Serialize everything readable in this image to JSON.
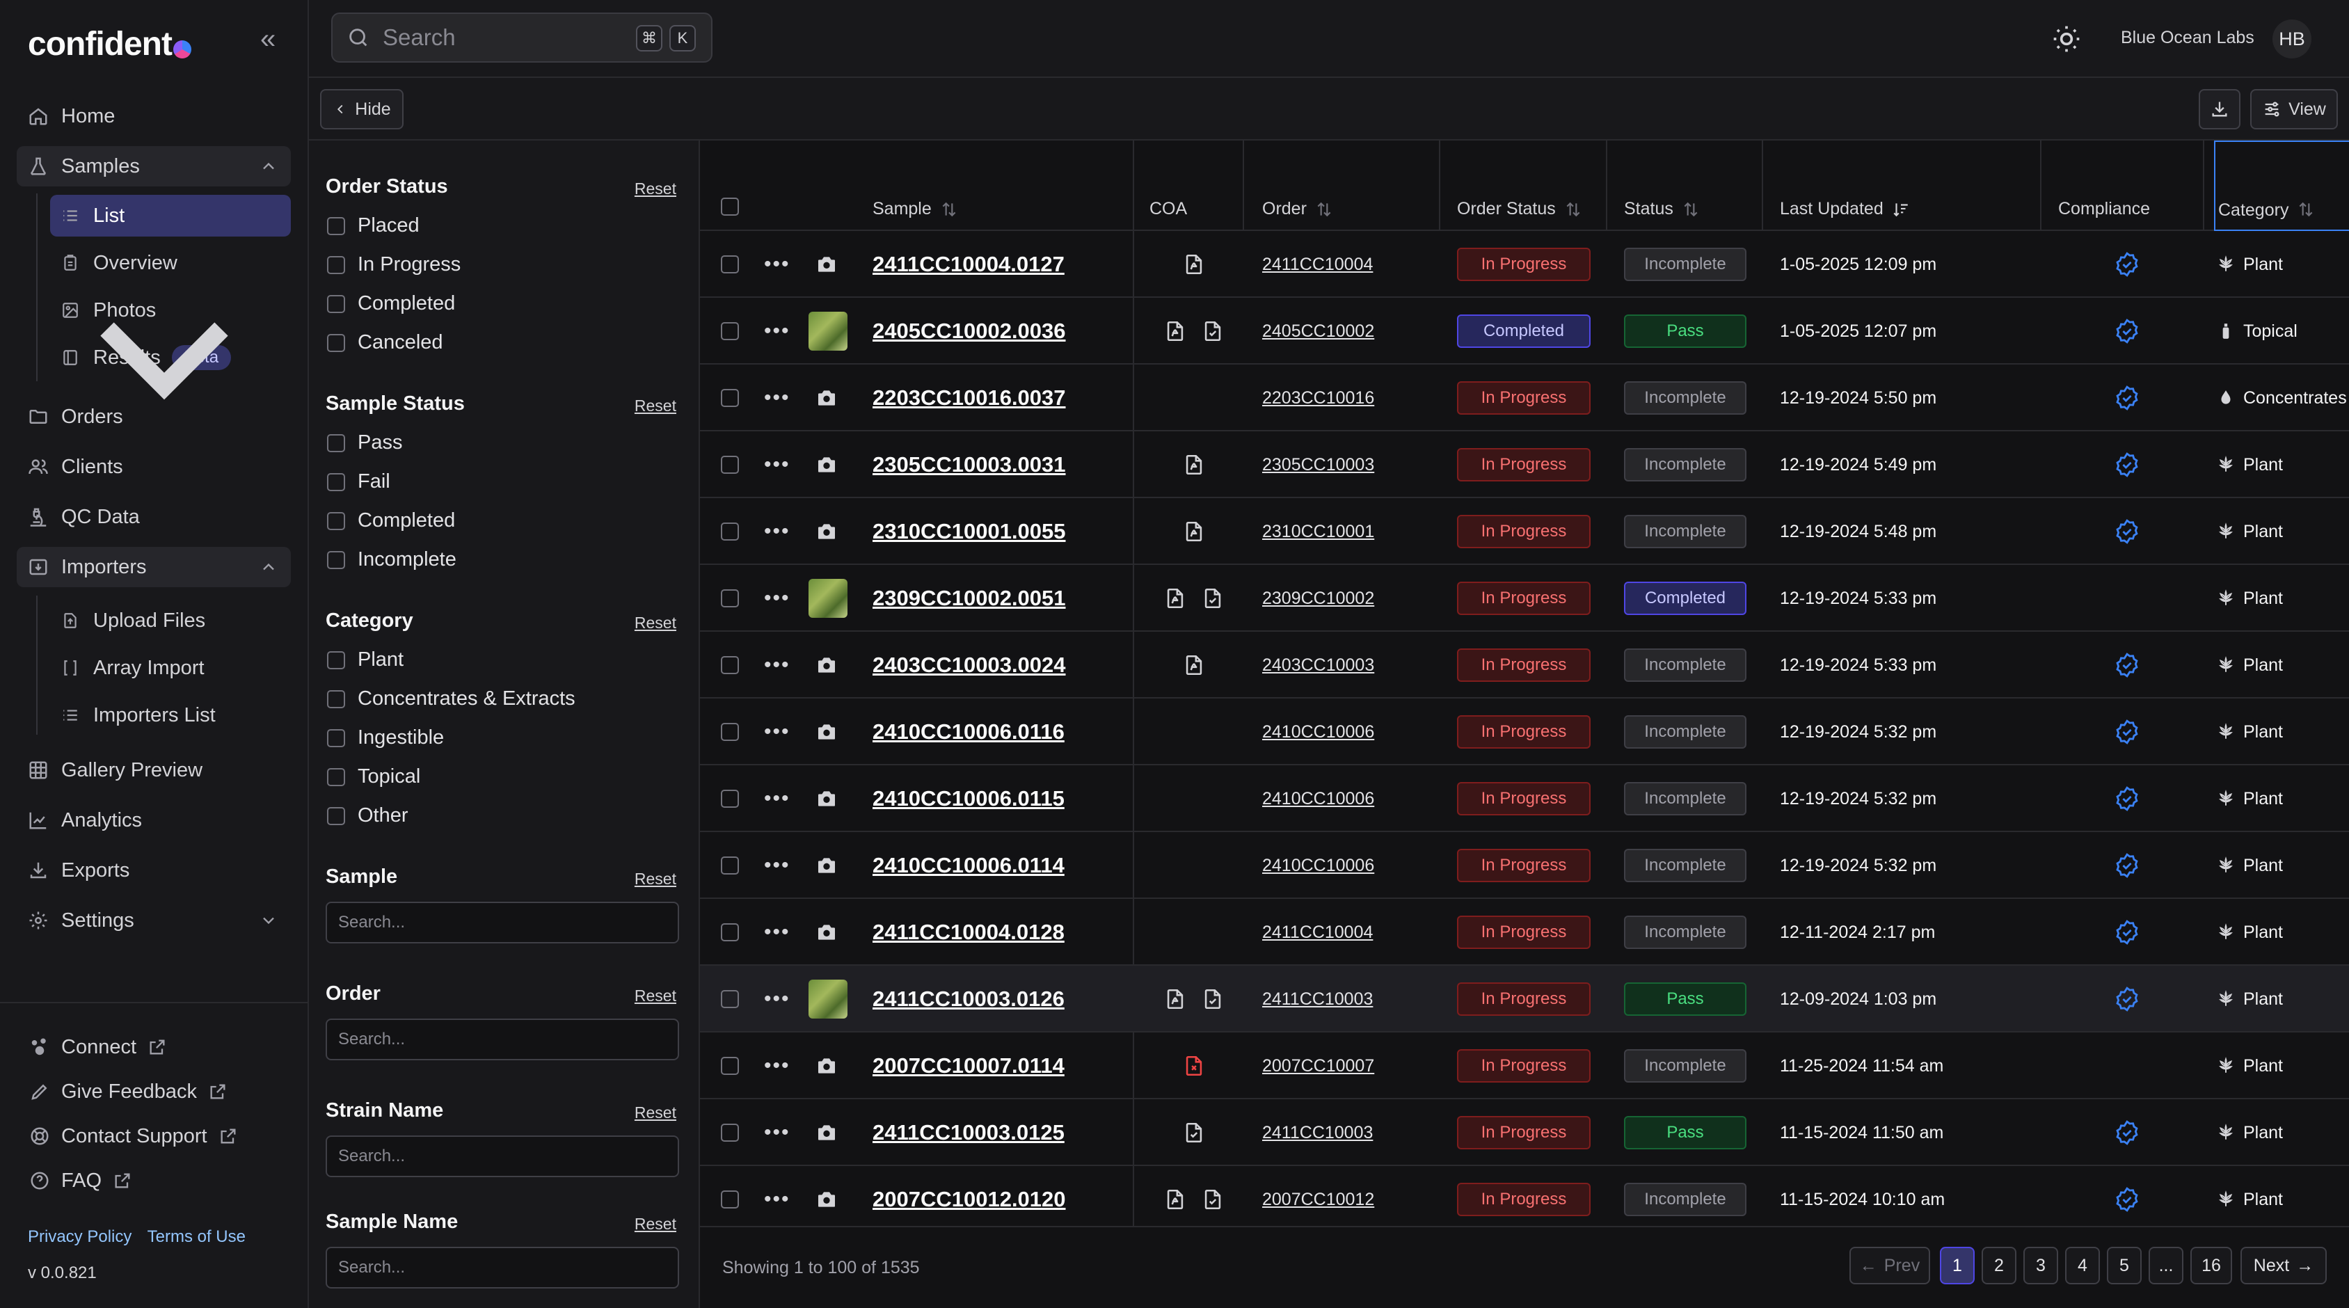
{
  "brand": {
    "name": "confident"
  },
  "nav": {
    "home": "Home",
    "samples": "Samples",
    "samples_sub": [
      "List",
      "Overview",
      "Photos",
      "Results"
    ],
    "results_badge": "Beta",
    "orders": "Orders",
    "clients": "Clients",
    "qc_data": "QC Data",
    "importers": "Importers",
    "importers_sub": [
      "Upload Files",
      "Array Import",
      "Importers List"
    ],
    "gallery": "Gallery Preview",
    "analytics": "Analytics",
    "exports": "Exports",
    "settings": "Settings",
    "connect": "Connect",
    "feedback": "Give Feedback",
    "support": "Contact Support",
    "faq": "FAQ",
    "privacy": "Privacy Policy",
    "terms": "Terms of Use",
    "version": "v 0.0.821"
  },
  "topbar": {
    "search_placeholder": "Search",
    "kbd_cmd": "⌘",
    "kbd_k": "K",
    "org": "Blue Ocean Labs",
    "user_initials": "HB"
  },
  "toolbar": {
    "hide_label": "Hide",
    "view_label": "View"
  },
  "filters": {
    "reset": "Reset",
    "order_status": {
      "title": "Order Status",
      "options": [
        "Placed",
        "In Progress",
        "Completed",
        "Canceled"
      ]
    },
    "sample_status": {
      "title": "Sample Status",
      "options": [
        "Pass",
        "Fail",
        "Completed",
        "Incomplete"
      ]
    },
    "category": {
      "title": "Category",
      "options": [
        "Plant",
        "Concentrates & Extracts",
        "Ingestible",
        "Topical",
        "Other"
      ]
    },
    "sample": {
      "title": "Sample",
      "placeholder": "Search..."
    },
    "order": {
      "title": "Order",
      "placeholder": "Search..."
    },
    "strain": {
      "title": "Strain Name",
      "placeholder": "Search..."
    },
    "sample_name": {
      "title": "Sample Name",
      "placeholder": "Search..."
    }
  },
  "table": {
    "columns": [
      "Sample",
      "COA",
      "Order",
      "Order Status",
      "Status",
      "Last Updated",
      "Compliance",
      "Category"
    ],
    "rows": [
      {
        "sample": "2411CC10004.0127",
        "photo": "camera",
        "coa": [
          "doc"
        ],
        "order": "2411CC10004",
        "order_status": "In Progress",
        "status": "Incomplete",
        "updated": "1-05-2025 12:09 pm",
        "compliance": true,
        "category": "Plant",
        "cat_icon": "leaf-icon"
      },
      {
        "sample": "2405CC10002.0036",
        "photo": "thumb",
        "coa": [
          "doc",
          "doc-check"
        ],
        "order": "2405CC10002",
        "order_status": "Completed",
        "status": "Pass",
        "updated": "1-05-2025 12:07 pm",
        "compliance": true,
        "category": "Topical",
        "cat_icon": "bottle-icon"
      },
      {
        "sample": "2203CC10016.0037",
        "photo": "camera",
        "coa": [],
        "order": "2203CC10016",
        "order_status": "In Progress",
        "status": "Incomplete",
        "updated": "12-19-2024 5:50 pm",
        "compliance": true,
        "category": "Concentrates",
        "cat_icon": "drop-icon"
      },
      {
        "sample": "2305CC10003.0031",
        "photo": "camera",
        "coa": [
          "doc"
        ],
        "order": "2305CC10003",
        "order_status": "In Progress",
        "status": "Incomplete",
        "updated": "12-19-2024 5:49 pm",
        "compliance": true,
        "category": "Plant",
        "cat_icon": "leaf-icon"
      },
      {
        "sample": "2310CC10001.0055",
        "photo": "camera",
        "coa": [
          "doc"
        ],
        "order": "2310CC10001",
        "order_status": "In Progress",
        "status": "Incomplete",
        "updated": "12-19-2024 5:48 pm",
        "compliance": true,
        "category": "Plant",
        "cat_icon": "leaf-icon"
      },
      {
        "sample": "2309CC10002.0051",
        "photo": "thumb",
        "coa": [
          "doc",
          "doc-check"
        ],
        "order": "2309CC10002",
        "order_status": "In Progress",
        "status": "Completed",
        "updated": "12-19-2024 5:33 pm",
        "compliance": false,
        "category": "Plant",
        "cat_icon": "leaf-icon"
      },
      {
        "sample": "2403CC10003.0024",
        "photo": "camera",
        "coa": [
          "doc"
        ],
        "order": "2403CC10003",
        "order_status": "In Progress",
        "status": "Incomplete",
        "updated": "12-19-2024 5:33 pm",
        "compliance": true,
        "category": "Plant",
        "cat_icon": "leaf-icon"
      },
      {
        "sample": "2410CC10006.0116",
        "photo": "camera",
        "coa": [],
        "order": "2410CC10006",
        "order_status": "In Progress",
        "status": "Incomplete",
        "updated": "12-19-2024 5:32 pm",
        "compliance": true,
        "category": "Plant",
        "cat_icon": "leaf-icon"
      },
      {
        "sample": "2410CC10006.0115",
        "photo": "camera",
        "coa": [],
        "order": "2410CC10006",
        "order_status": "In Progress",
        "status": "Incomplete",
        "updated": "12-19-2024 5:32 pm",
        "compliance": true,
        "category": "Plant",
        "cat_icon": "leaf-icon"
      },
      {
        "sample": "2410CC10006.0114",
        "photo": "camera",
        "coa": [],
        "order": "2410CC10006",
        "order_status": "In Progress",
        "status": "Incomplete",
        "updated": "12-19-2024 5:32 pm",
        "compliance": true,
        "category": "Plant",
        "cat_icon": "leaf-icon"
      },
      {
        "sample": "2411CC10004.0128",
        "photo": "camera",
        "coa": [],
        "order": "2411CC10004",
        "order_status": "In Progress",
        "status": "Incomplete",
        "updated": "12-11-2024 2:17 pm",
        "compliance": true,
        "category": "Plant",
        "cat_icon": "leaf-icon"
      },
      {
        "sample": "2411CC10003.0126",
        "photo": "thumb",
        "coa": [
          "doc",
          "doc-check"
        ],
        "order": "2411CC10003",
        "order_status": "In Progress",
        "status": "Pass",
        "updated": "12-09-2024 1:03 pm",
        "compliance": true,
        "category": "Plant",
        "cat_icon": "leaf-icon",
        "highlight": true
      },
      {
        "sample": "2007CC10007.0114",
        "photo": "camera",
        "coa": [
          "doc-error"
        ],
        "order": "2007CC10007",
        "order_status": "In Progress",
        "status": "Incomplete",
        "updated": "11-25-2024 11:54 am",
        "compliance": false,
        "category": "Plant",
        "cat_icon": "leaf-icon"
      },
      {
        "sample": "2411CC10003.0125",
        "photo": "camera",
        "coa": [
          "doc-check"
        ],
        "order": "2411CC10003",
        "order_status": "In Progress",
        "status": "Pass",
        "updated": "11-15-2024 11:50 am",
        "compliance": true,
        "category": "Plant",
        "cat_icon": "leaf-icon"
      },
      {
        "sample": "2007CC10012.0120",
        "photo": "camera",
        "coa": [
          "doc",
          "doc-check"
        ],
        "order": "2007CC10012",
        "order_status": "In Progress",
        "status": "Incomplete",
        "updated": "11-15-2024 10:10 am",
        "compliance": true,
        "category": "Plant",
        "cat_icon": "leaf-icon"
      }
    ]
  },
  "footer": {
    "showing": "Showing 1 to 100 of 1535",
    "prev": "Prev",
    "next": "Next",
    "pages": [
      "1",
      "2",
      "3",
      "4",
      "5",
      "...",
      "16"
    ],
    "current_page": "1"
  },
  "colors": {
    "accent": "#34356a",
    "in_progress": "#f87171",
    "pass": "#4ade80",
    "compliance": "#3b82f6"
  }
}
